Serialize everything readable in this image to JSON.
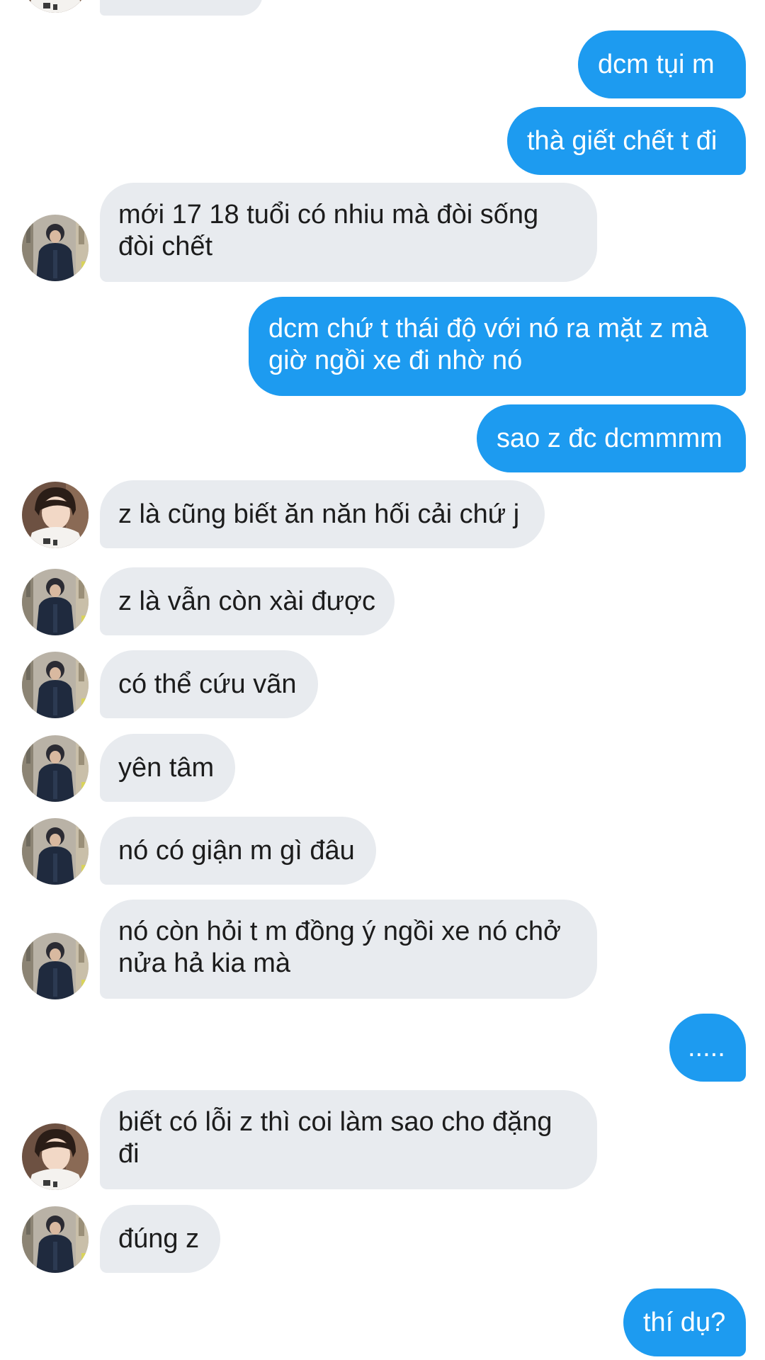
{
  "messages": [
    {
      "side": "out",
      "lines": [
        "dcm tụi m"
      ]
    },
    {
      "side": "out",
      "lines": [
        "thà giết chết t đi"
      ]
    },
    {
      "side": "in",
      "avatar": "avatar-dark-jacket",
      "lines": [
        "mới 17 18 tuổi có nhiu mà đòi sống",
        "đòi chết"
      ]
    },
    {
      "side": "out",
      "lines": [
        "dcm chứ t thái độ với nó ra mặt z mà",
        "giờ ngồi xe đi nhờ nó"
      ]
    },
    {
      "side": "out",
      "lines": [
        "sao z đc dcmmmm"
      ]
    },
    {
      "side": "in",
      "avatar": "avatar-white-shirt",
      "lines": [
        "z là cũng biết ăn năn hối cải chứ j"
      ]
    },
    {
      "side": "in",
      "avatar": "avatar-dark-jacket",
      "lines": [
        "z là vẫn còn xài được"
      ]
    },
    {
      "side": "in",
      "avatar": "avatar-dark-jacket",
      "lines": [
        "có thể cứu vãn"
      ]
    },
    {
      "side": "in",
      "avatar": "avatar-dark-jacket",
      "lines": [
        "yên tâm"
      ]
    },
    {
      "side": "in",
      "avatar": "avatar-dark-jacket",
      "lines": [
        "nó có giận m gì đâu"
      ]
    },
    {
      "side": "in",
      "avatar": "avatar-dark-jacket",
      "lines": [
        "nó còn hỏi t m đồng ý ngồi xe nó chở",
        "nửa hả kia mà"
      ]
    },
    {
      "side": "out",
      "lines": [
        "....."
      ]
    },
    {
      "side": "in",
      "avatar": "avatar-white-shirt",
      "lines": [
        "biết có lỗi z thì coi làm sao cho đặng",
        "đi"
      ]
    },
    {
      "side": "in",
      "avatar": "avatar-dark-jacket",
      "lines": [
        "đúng z"
      ]
    },
    {
      "side": "out",
      "lines": [
        "thí dụ?"
      ]
    }
  ],
  "colors": {
    "outgoing_bubble": "#1d9bf0",
    "incoming_bubble": "#e8ebef",
    "incoming_text": "#1c1c1c",
    "outgoing_text": "#ffffff",
    "background": "#ffffff"
  }
}
